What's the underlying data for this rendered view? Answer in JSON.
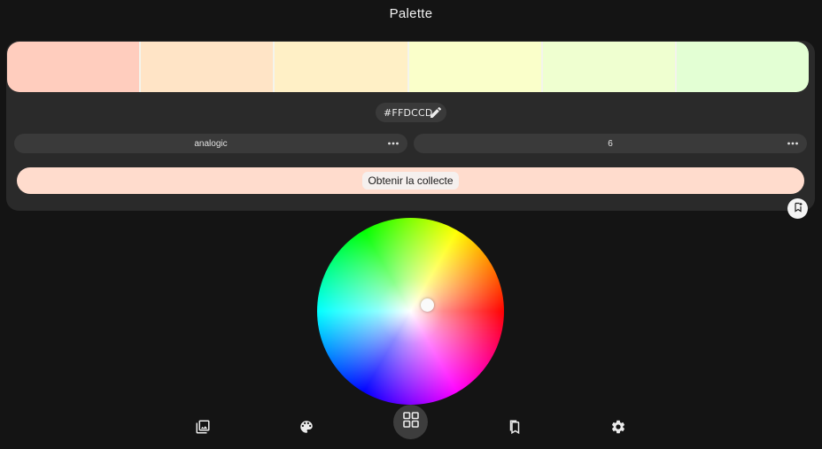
{
  "header": {
    "title": "Palette"
  },
  "palette": {
    "swatches": [
      {
        "color": "#FFCDBE"
      },
      {
        "color": "#FFE4C6"
      },
      {
        "color": "#FFF0C6"
      },
      {
        "color": "#FAFFCA"
      },
      {
        "color": "#EFFFD0"
      },
      {
        "color": "#E3FFD4"
      }
    ],
    "hex_value": "#FFDCCD",
    "scheme_select": {
      "value": "analogic"
    },
    "count_select": {
      "value": "6"
    },
    "collect_button_label": "Obtenir la collecte"
  },
  "colors": {
    "card_bg": "#2A2A2A",
    "accent": "#FFDCCD",
    "page_bg": "#141414"
  },
  "nav": [
    {
      "icon": "gallery-icon"
    },
    {
      "icon": "palette-icon"
    },
    {
      "icon": "grid-icon",
      "active": true
    },
    {
      "icon": "bookmarks-icon"
    },
    {
      "icon": "gear-icon"
    }
  ]
}
